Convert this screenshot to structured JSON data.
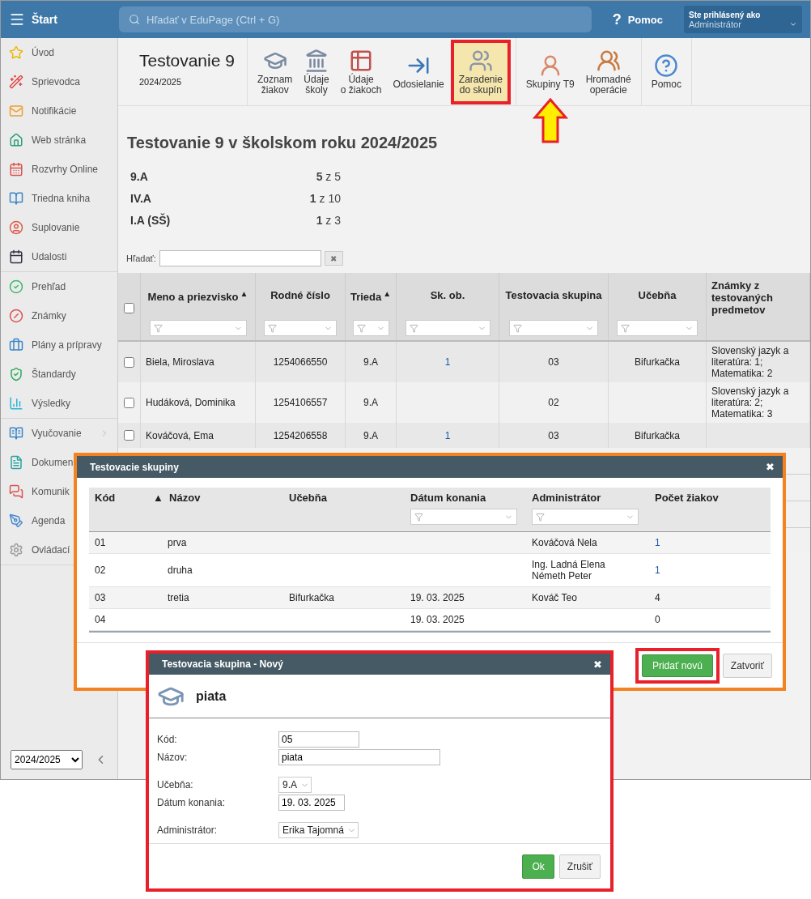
{
  "topbar": {
    "menu_label": "Štart",
    "search_placeholder": "Hľadať v EduPage (Ctrl + G)",
    "help_icon": "?",
    "help": "Pomoc",
    "user_caption": "Ste prihlásený ako",
    "user_role": "Administrátor"
  },
  "sidebar": {
    "groups": [
      [
        {
          "label": "Úvod"
        },
        {
          "label": "Sprievodca"
        },
        {
          "label": "Notifikácie"
        },
        {
          "label": "Web stránka"
        },
        {
          "label": "Rozvrhy Online"
        },
        {
          "label": "Triedna kniha"
        },
        {
          "label": "Suplovanie"
        },
        {
          "label": "Udalosti"
        }
      ],
      [
        {
          "label": "Prehľad"
        },
        {
          "label": "Známky"
        },
        {
          "label": "Plány a prípravy"
        },
        {
          "label": "Štandardy"
        },
        {
          "label": "Výsledky"
        }
      ],
      [
        {
          "label": "Vyučovanie",
          "submenu": true
        },
        {
          "label": "Dokumen"
        },
        {
          "label": "Komunik"
        },
        {
          "label": "Agenda"
        },
        {
          "label": "Ovládací"
        }
      ]
    ],
    "year": "2024/2025"
  },
  "toolbar": {
    "title": "Testovanie 9",
    "subtitle": "2024/2025",
    "items": [
      {
        "label": "Zoznam\nžiakov",
        "highlighted": false,
        "arrow": false
      },
      {
        "label": "Údaje\nškoly",
        "highlighted": false,
        "arrow": false
      },
      {
        "label": "Údaje\no žiakoch",
        "highlighted": false,
        "arrow": false
      },
      {
        "label": "Odosielanie",
        "highlighted": false,
        "arrow": false
      },
      {
        "label": "Zaradenie\ndo skupín",
        "highlighted": true,
        "arrow": false
      },
      {
        "label": "Skupiny T9",
        "highlighted": false,
        "arrow": true
      },
      {
        "label": "Hromadné\noperácie",
        "highlighted": false,
        "arrow": false
      },
      {
        "label": "Pomoc",
        "highlighted": false,
        "arrow": false
      }
    ]
  },
  "heading": "Testovanie 9 v školskom roku 2024/2025",
  "classes": [
    {
      "name": "9.A",
      "count": "**5** z 5"
    },
    {
      "name": "IV.A",
      "count": "**1** z 10"
    },
    {
      "name": "I.A (SŠ)",
      "count": "**1** z 3"
    }
  ],
  "search": {
    "label": "Hľadať:",
    "clear": "✖"
  },
  "table": {
    "select_all_checked": false,
    "columns": [
      {
        "label": "Meno a priezvisko",
        "sort_mark": "▲",
        "filter": true
      },
      {
        "label": "Rodné číslo",
        "filter": true
      },
      {
        "label": "Trieda",
        "sort_mark": "▲",
        "filter": true
      },
      {
        "label": "Sk. ob.",
        "filter": true
      },
      {
        "label": "Testovacia skupina",
        "filter": true
      },
      {
        "label": "Učebňa",
        "filter": true
      },
      {
        "label": "Známky z testovaných predmetov",
        "filter": false
      }
    ],
    "rows": [
      {
        "checked": false,
        "name": "Biela, Miroslava",
        "birth_number": "1254066550",
        "class": "9.A",
        "sk_ob": "1",
        "group": "03",
        "room": "Bifurkačka",
        "grades": "Slovenský jazyk a literatúra: 1; Matematika: 2"
      },
      {
        "checked": false,
        "name": "Hudáková, Dominika",
        "birth_number": "1254106557",
        "class": "9.A",
        "sk_ob": "",
        "group": "02",
        "room": "",
        "grades": "Slovenský jazyk a literatúra: 2; Matematika: 3"
      },
      {
        "checked": false,
        "name": "Kováčová, Ema",
        "birth_number": "1254206558",
        "class": "9.A",
        "sk_ob": "1",
        "group": "03",
        "room": "Bifurkačka",
        "grades": ""
      }
    ]
  },
  "groups_dialog": {
    "title": "Testovacie skupiny",
    "close": "✖",
    "columns": [
      {
        "label": "Kód",
        "filter": false
      },
      {
        "label": "Názov",
        "sort_mark": "▲",
        "filter": false
      },
      {
        "label": "Učebňa",
        "filter": false
      },
      {
        "label": "Dátum konania",
        "filter": true
      },
      {
        "label": "Administrátor",
        "filter": true
      },
      {
        "label": "Počet žiakov",
        "filter": false
      }
    ],
    "rows": [
      {
        "code": "01",
        "name": "prva",
        "room": "",
        "date": "",
        "admins": [
          "Kováčová Nela"
        ],
        "count": "1",
        "count_link": true
      },
      {
        "code": "02",
        "name": "druha",
        "room": "",
        "date": "",
        "admins": [
          "Ing. Ladná Elena",
          "Németh Peter"
        ],
        "count": "1",
        "count_link": true
      },
      {
        "code": "03",
        "name": "tretia",
        "room": "Bifurkačka",
        "date": "19. 03. 2025",
        "admins": [
          "Kováč Teo"
        ],
        "count": "4",
        "count_link": false
      },
      {
        "code": "04",
        "name": "",
        "room": "",
        "date": "19. 03. 2025",
        "admins": [],
        "count": "0",
        "count_link": false
      }
    ],
    "add_button": {
      "label": "Pridať novú",
      "highlighted": true
    },
    "close_button": "Zatvoriť"
  },
  "new_dialog": {
    "title": "Testovacia skupina - Nový",
    "close": "✖",
    "name": "piata",
    "field_groups": [
      [
        {
          "label": "Kód:",
          "kind": "text",
          "value": "05"
        },
        {
          "label": "Názov:",
          "kind": "text",
          "value": "piata"
        }
      ],
      [
        {
          "label": "Učebňa:",
          "kind": "select",
          "value": "9.A"
        },
        {
          "label": "Dátum konania:",
          "kind": "text",
          "value": "19. 03. 2025"
        }
      ],
      [
        {
          "label": "Administrátor:",
          "kind": "select",
          "value": "Erika Tajomná"
        }
      ]
    ],
    "ok": "Ok",
    "cancel": "Zrušiť"
  }
}
